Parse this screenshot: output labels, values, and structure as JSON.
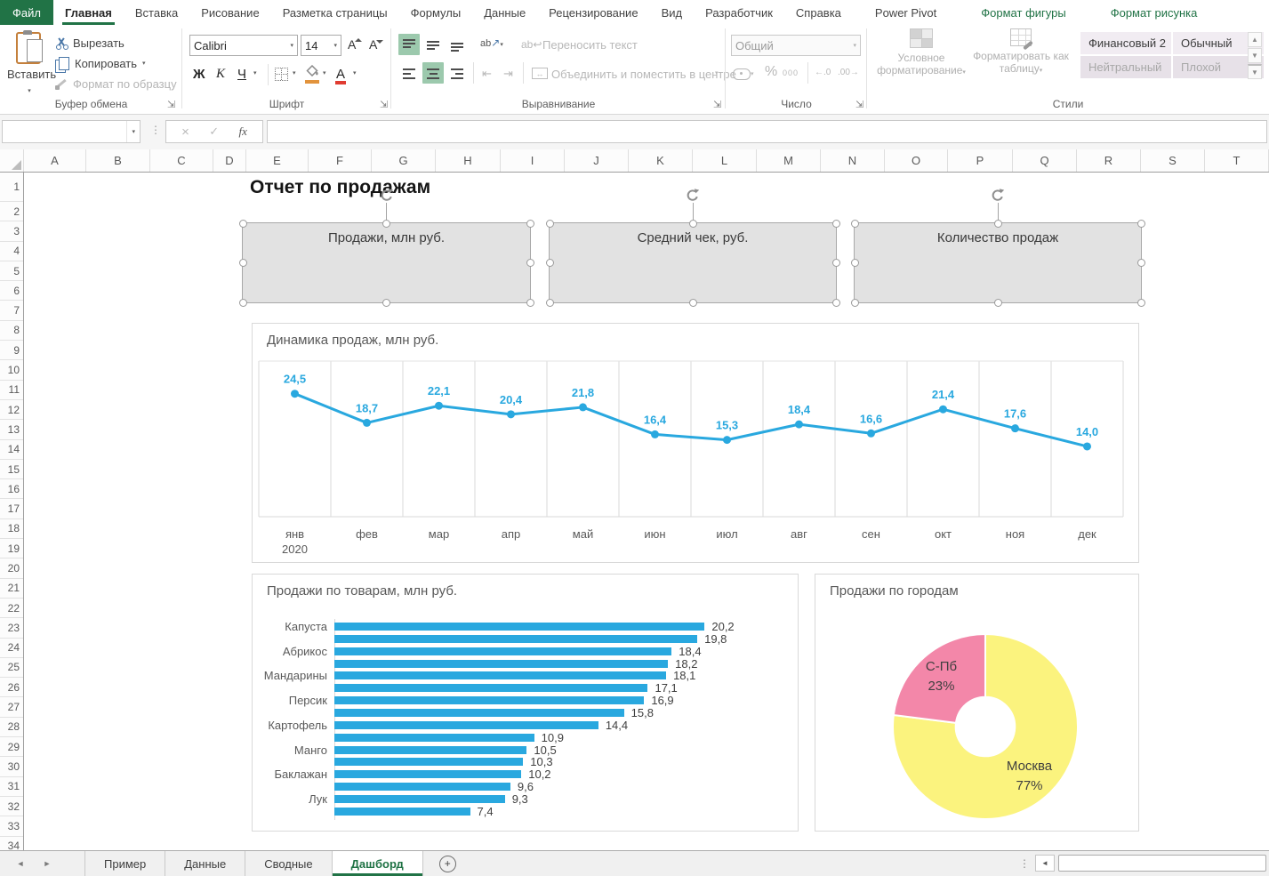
{
  "ribbon": {
    "file_tab": "Файл",
    "tabs": [
      {
        "label": "Главная",
        "active": true
      },
      {
        "label": "Вставка"
      },
      {
        "label": "Рисование"
      },
      {
        "label": "Разметка страницы"
      },
      {
        "label": "Формулы"
      },
      {
        "label": "Данные"
      },
      {
        "label": "Рецензирование"
      },
      {
        "label": "Вид"
      },
      {
        "label": "Разработчик"
      },
      {
        "label": "Справка"
      },
      {
        "label": "Power Pivot"
      },
      {
        "label": "Формат фигуры",
        "contextual": true
      },
      {
        "label": "Формат рисунка",
        "contextual": true
      }
    ],
    "clipboard": {
      "group_label": "Буфер обмена",
      "paste_label": "Вставить",
      "cut_label": "Вырезать",
      "copy_label": "Копировать",
      "format_painter_label": "Формат по образцу"
    },
    "font": {
      "group_label": "Шрифт",
      "font_name": "Calibri",
      "font_size": "14",
      "bold_label": "Ж",
      "italic_label": "К",
      "underline_label": "Ч"
    },
    "alignment": {
      "group_label": "Выравнивание",
      "orientation_label": "ab",
      "wrap_label": "Переносить текст",
      "merge_label": "Объединить и поместить в центре"
    },
    "number": {
      "group_label": "Число",
      "format_value": "Общий",
      "percent_label": "%",
      "thousands_label": "000",
      "dec_increase_label": "←.0",
      "dec_decrease_label": ".00→"
    },
    "styles": {
      "group_label": "Стили",
      "conditional_label": "Условное форматирование",
      "format_table_label": "Форматировать как таблицу",
      "gallery": [
        {
          "label": "Финансовый 2",
          "enabled": true
        },
        {
          "label": "Обычный",
          "enabled": true
        },
        {
          "label": "Нейтральный",
          "enabled": false
        },
        {
          "label": "Плохой",
          "enabled": false
        }
      ]
    }
  },
  "formula_bar": {
    "name_box_value": "",
    "fx_label": "fx",
    "formula_value": ""
  },
  "icons": {
    "dropdown_caret": "▾",
    "cancel": "×",
    "enter": "✓",
    "dialog_launcher": "⇲",
    "splitter_dots": "⋮",
    "nav_left": "◄",
    "nav_right": "►",
    "scroll_left": "◄",
    "add_sheet": "+"
  },
  "grid": {
    "column_headers": [
      "A",
      "B",
      "C",
      "D",
      "E",
      "F",
      "G",
      "H",
      "I",
      "J",
      "K",
      "L",
      "M",
      "N",
      "O",
      "P",
      "Q",
      "R",
      "S",
      "T"
    ],
    "row_start": 1,
    "row_end": 34
  },
  "sheet_content": {
    "report_title": "Отчет по продажам",
    "kpi_shapes": [
      "Продажи, млн руб.",
      "Средний чек, руб.",
      "Количество продаж"
    ]
  },
  "chart_data": [
    {
      "type": "line",
      "title": "Динамика продаж, млн руб.",
      "x": [
        "янв\n2020",
        "фев",
        "мар",
        "апр",
        "май",
        "июн",
        "июл",
        "авг",
        "сен",
        "окт",
        "ноя",
        "дек"
      ],
      "values": [
        24.5,
        18.7,
        22.1,
        20.4,
        21.8,
        16.4,
        15.3,
        18.4,
        16.6,
        21.4,
        17.6,
        14.0
      ],
      "value_labels": [
        "24,5",
        "18,7",
        "22,1",
        "20,4",
        "21,8",
        "16,4",
        "15,3",
        "18,4",
        "16,6",
        "21,4",
        "17,6",
        "14,0"
      ],
      "line_color": "#29a8df",
      "ylim": [
        0,
        31
      ],
      "grid": "vertical-bands",
      "legend": "none"
    },
    {
      "type": "bar",
      "orientation": "horizontal",
      "title": "Продажи по товарам, млн руб.",
      "category_labels": [
        "Капуста",
        "Абрикос",
        "Мандарины",
        "Персик",
        "Картофель",
        "Манго",
        "Баклажан",
        "Лук"
      ],
      "label_every": 2,
      "values": [
        20.2,
        19.8,
        18.4,
        18.2,
        18.1,
        17.1,
        16.9,
        15.8,
        14.4,
        10.9,
        10.5,
        10.3,
        10.2,
        9.6,
        9.3,
        7.4
      ],
      "value_labels": [
        "20,2",
        "19,8",
        "18,4",
        "18,2",
        "18,1",
        "17,1",
        "16,9",
        "15,8",
        "14,4",
        "10,9",
        "10,5",
        "10,3",
        "10,2",
        "9,6",
        "9,3",
        "7,4"
      ],
      "bar_color": "#29a8df",
      "xlim": [
        0,
        24.5
      ],
      "legend": "none"
    },
    {
      "type": "pie",
      "subtype": "donut",
      "title": "Продажи по городам",
      "slices": [
        {
          "name": "Москва",
          "pct": 77,
          "label": "Москва\n77%",
          "color": "#fbf37e"
        },
        {
          "name": "С-Пб",
          "pct": 23,
          "label": "С-Пб\n23%",
          "color": "#f387a9"
        }
      ],
      "start_angle_deg": 0,
      "clockwise": true,
      "hole_ratio": 0.32,
      "legend": "none"
    }
  ],
  "sheet_tabs": {
    "tabs": [
      {
        "label": "Пример"
      },
      {
        "label": "Данные"
      },
      {
        "label": "Сводные"
      },
      {
        "label": "Дашборд",
        "active": true
      }
    ],
    "add_label": "+"
  }
}
